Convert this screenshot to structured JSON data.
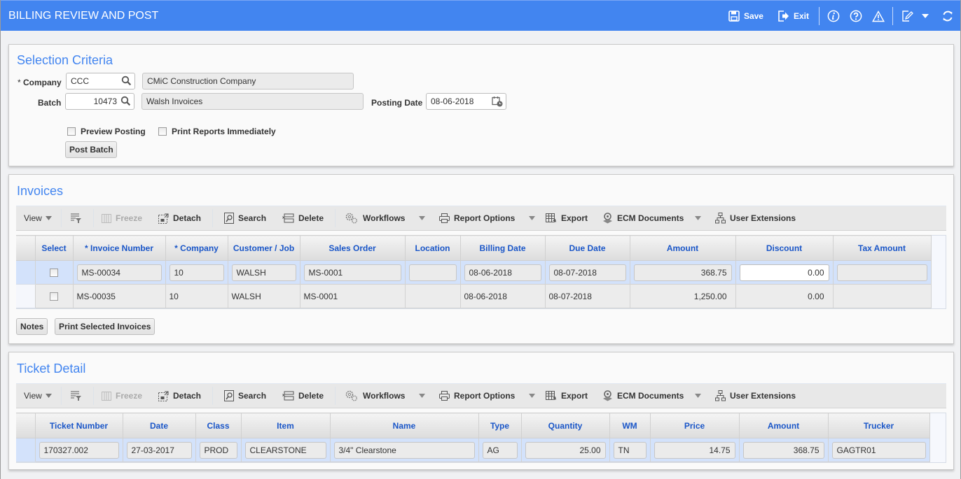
{
  "app": {
    "title": "BILLING REVIEW AND POST",
    "actions": {
      "save_label": "Save",
      "exit_label": "Exit",
      "icons": [
        "info-icon",
        "help-icon",
        "warning-icon",
        "edit-note-icon",
        "caret-down-icon",
        "refresh-icon"
      ]
    }
  },
  "selection": {
    "heading": "Selection Criteria",
    "company": {
      "label": "Company",
      "required_mark": "* ",
      "value": "CCC",
      "description": "CMiC Construction Company"
    },
    "batch": {
      "label": "Batch",
      "value": "10473",
      "description": "Walsh Invoices"
    },
    "posting_date": {
      "label": "Posting Date",
      "value": "08-06-2018"
    },
    "preview_posting": {
      "label": "Preview Posting",
      "checked": false
    },
    "print_reports": {
      "label": "Print Reports Immediately",
      "checked": false
    },
    "post_batch_label": "Post Batch"
  },
  "toolbar": {
    "view": "View",
    "freeze": "Freeze",
    "detach": "Detach",
    "search": "Search",
    "delete": "Delete",
    "workflows": "Workflows",
    "report_options": "Report Options",
    "export": "Export",
    "ecm_documents": "ECM Documents",
    "user_extensions": "User Extensions"
  },
  "invoices": {
    "heading": "Invoices",
    "columns": [
      "Select",
      "* Invoice Number",
      "* Company",
      "Customer / Job",
      "Sales Order",
      "Location",
      "Billing Date",
      "Due Date",
      "Amount",
      "Discount",
      "Tax Amount"
    ],
    "rows": [
      {
        "selected": false,
        "invoice_number": "MS-00034",
        "company": "10",
        "customer_job": "WALSH",
        "sales_order": "MS-0001",
        "location": "",
        "billing_date": "08-06-2018",
        "due_date": "08-07-2018",
        "amount": "368.75",
        "discount": "0.00",
        "tax_amount": ""
      },
      {
        "selected": false,
        "invoice_number": "MS-00035",
        "company": "10",
        "customer_job": "WALSH",
        "sales_order": "MS-0001",
        "location": "",
        "billing_date": "08-06-2018",
        "due_date": "08-07-2018",
        "amount": "1,250.00",
        "discount": "0.00",
        "tax_amount": ""
      }
    ],
    "notes_label": "Notes",
    "print_selected_label": "Print Selected Invoices"
  },
  "tickets": {
    "heading": "Ticket Detail",
    "columns": [
      "Ticket Number",
      "Date",
      "Class",
      "Item",
      "Name",
      "Type",
      "Quantity",
      "WM",
      "Price",
      "Amount",
      "Trucker"
    ],
    "rows": [
      {
        "ticket_number": "170327.002",
        "date": "27-03-2017",
        "class": "PROD",
        "item": "CLEARSTONE",
        "name": "3/4\" Clearstone",
        "type": "AG",
        "quantity": "25.00",
        "wm": "TN",
        "price": "14.75",
        "amount": "368.75",
        "trucker": "GAGTR01"
      }
    ]
  }
}
